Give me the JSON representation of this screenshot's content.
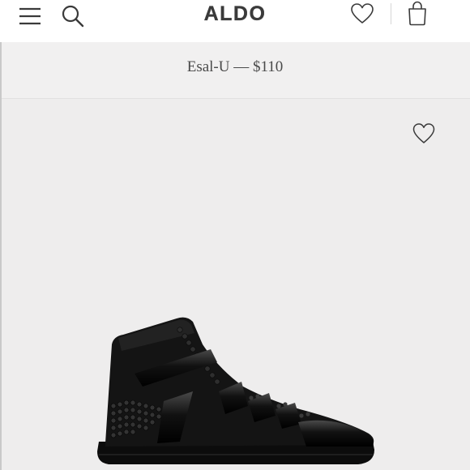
{
  "header": {
    "logo": "ALDO",
    "icons": {
      "menu": "menu-icon",
      "search": "search-icon",
      "wishlist": "heart-icon",
      "bag": "shopping-bag-icon"
    }
  },
  "product": {
    "title": "Esal-U — $110",
    "image": "black-high-top-sneaker-image",
    "favorite_icon": "heart-icon"
  },
  "colors": {
    "header_bg": "#ffffff",
    "title_bar_bg": "#f1f0f0",
    "image_bg": "#eeeded",
    "logo": "#3a3a3a",
    "text": "#4a4a4a"
  }
}
